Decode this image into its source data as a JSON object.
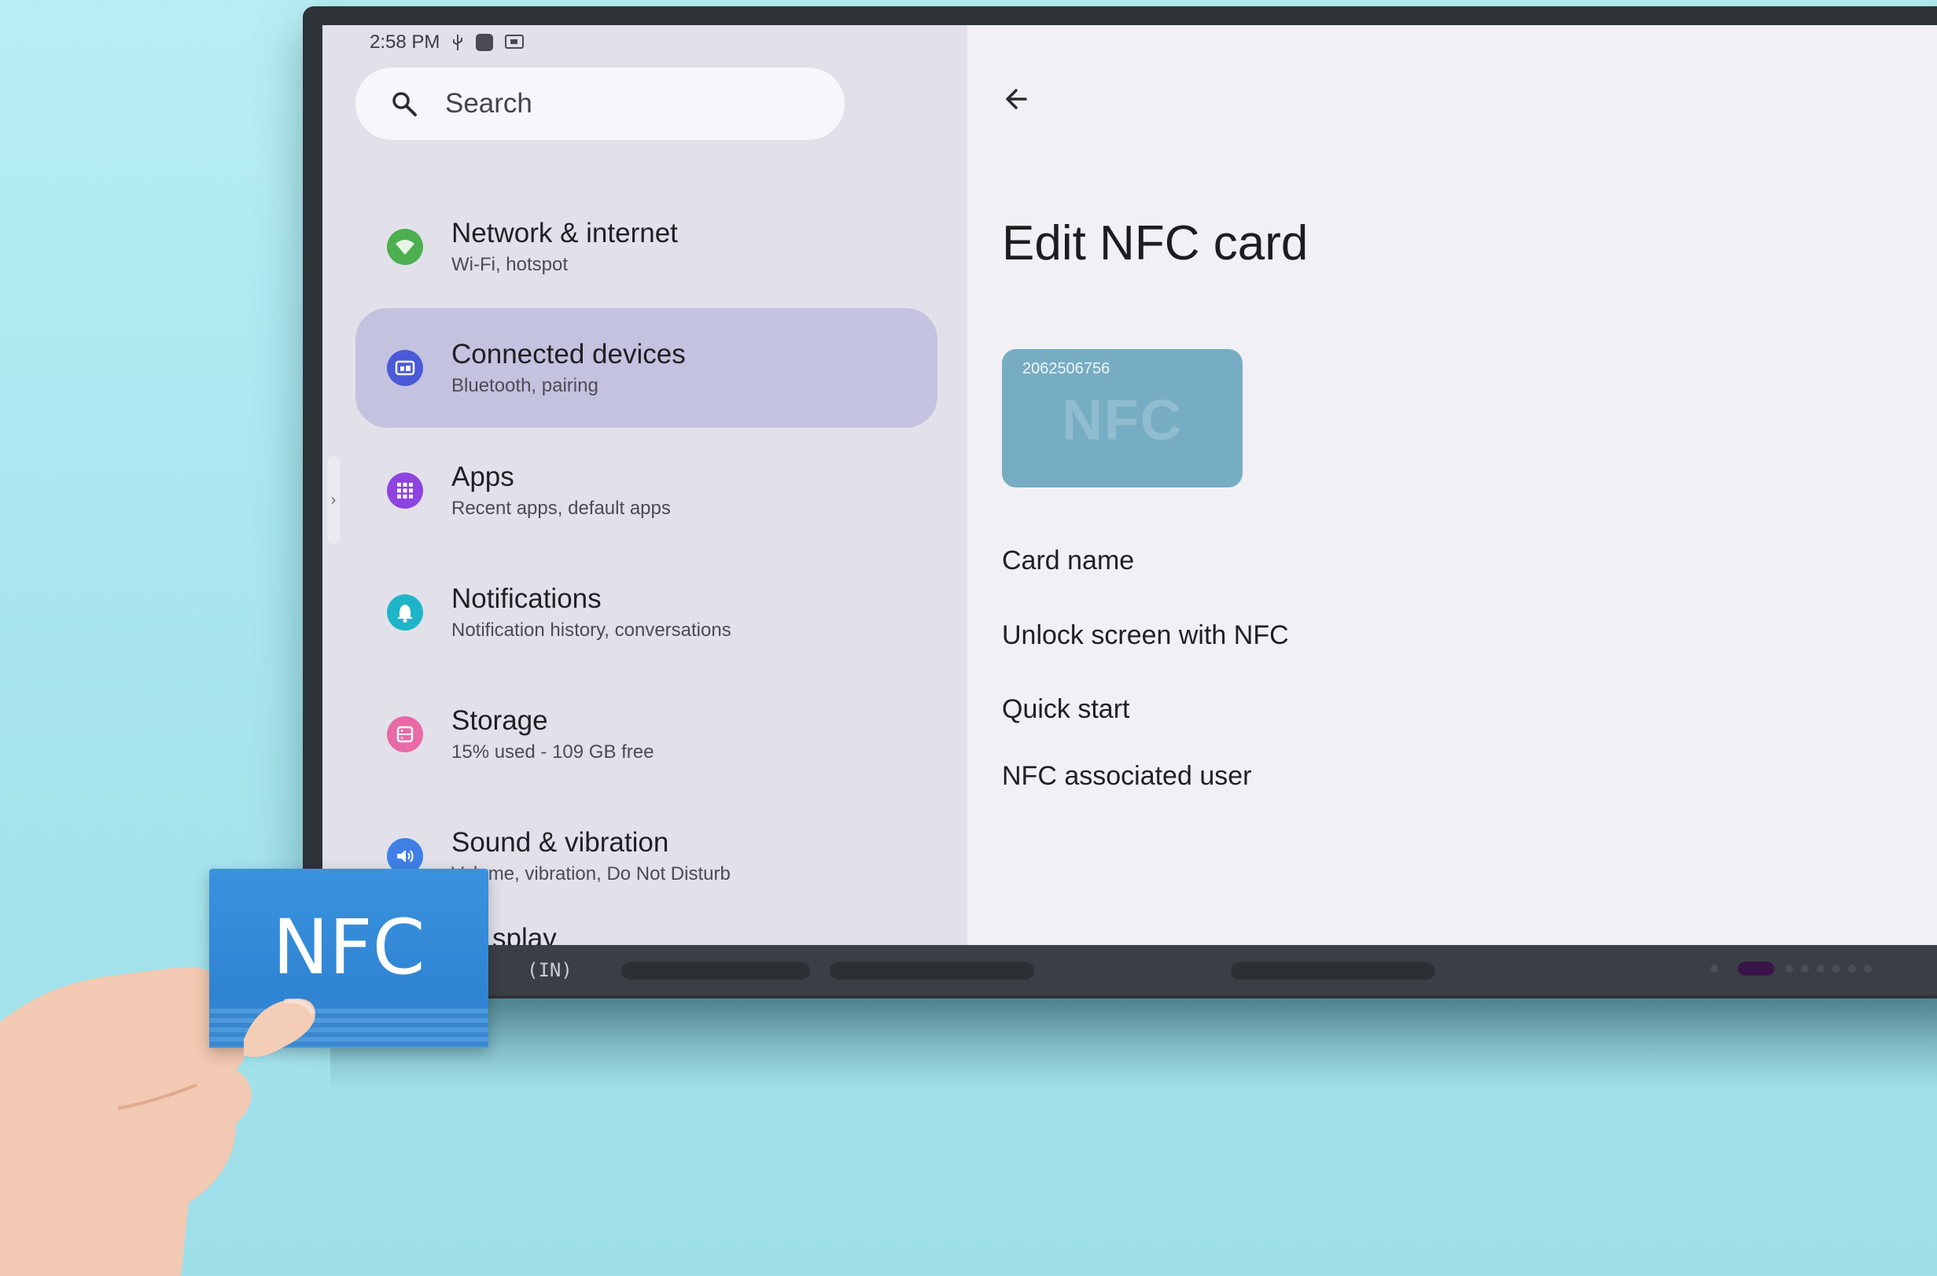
{
  "status_bar": {
    "time": "2:58 PM"
  },
  "search": {
    "placeholder": "Search"
  },
  "sidebar": {
    "items": [
      {
        "title": "Network & internet",
        "subtitle": "Wi-Fi, hotspot",
        "icon": "wifi-icon",
        "color": "#4caf50"
      },
      {
        "title": "Connected devices",
        "subtitle": "Bluetooth, pairing",
        "icon": "devices-icon",
        "color": "#4a5ad8",
        "selected": true
      },
      {
        "title": "Apps",
        "subtitle": "Recent apps, default apps",
        "icon": "apps-grid-icon",
        "color": "#8e44e0"
      },
      {
        "title": "Notifications",
        "subtitle": "Notification history, conversations",
        "icon": "bell-icon",
        "color": "#1fb5c9"
      },
      {
        "title": "Storage",
        "subtitle": "15% used - 109 GB free",
        "icon": "storage-icon",
        "color": "#e86aa6"
      },
      {
        "title": "Sound & vibration",
        "subtitle": "Volume, vibration, Do Not Disturb",
        "icon": "speaker-icon",
        "color": "#3f7fe6"
      }
    ],
    "partial_item": "splay"
  },
  "detail": {
    "title": "Edit NFC card",
    "card_number": "2062506756",
    "card_logo": "NFC",
    "options": [
      "Card name",
      "Unlock screen with NFC",
      "Quick start",
      "NFC associated user"
    ]
  },
  "bezel": {
    "logo": "(IN)"
  },
  "physical_card": {
    "logo": "NFC"
  }
}
